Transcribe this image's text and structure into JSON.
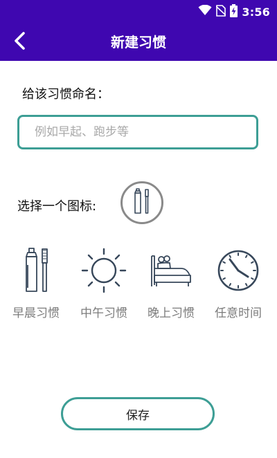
{
  "status_bar": {
    "time": "3:56",
    "icons": [
      "wifi-icon",
      "no-sim-icon",
      "battery-charging-icon"
    ]
  },
  "app_bar": {
    "title": "新建习惯",
    "back_icon": "chevron-left-icon"
  },
  "form": {
    "name_label": "给该习惯命名：",
    "name_input": {
      "value": "",
      "placeholder": "例如早起、跑步等"
    },
    "icon_label": "选择一个图标:",
    "selected_icon": "toothbrush-toothpaste-icon"
  },
  "habit_options": [
    {
      "label": "早晨习惯",
      "icon": "toothbrush-toothpaste-icon"
    },
    {
      "label": "中午习惯",
      "icon": "sun-icon"
    },
    {
      "label": "晚上习惯",
      "icon": "bed-icon"
    },
    {
      "label": "任意时间",
      "icon": "clock-icon"
    }
  ],
  "save_label": "保存",
  "colors": {
    "primary": "#3f07b0",
    "accent_border": "#3d9e95",
    "icon_stroke": "#37475a",
    "label_gray": "#7b7b7b"
  }
}
